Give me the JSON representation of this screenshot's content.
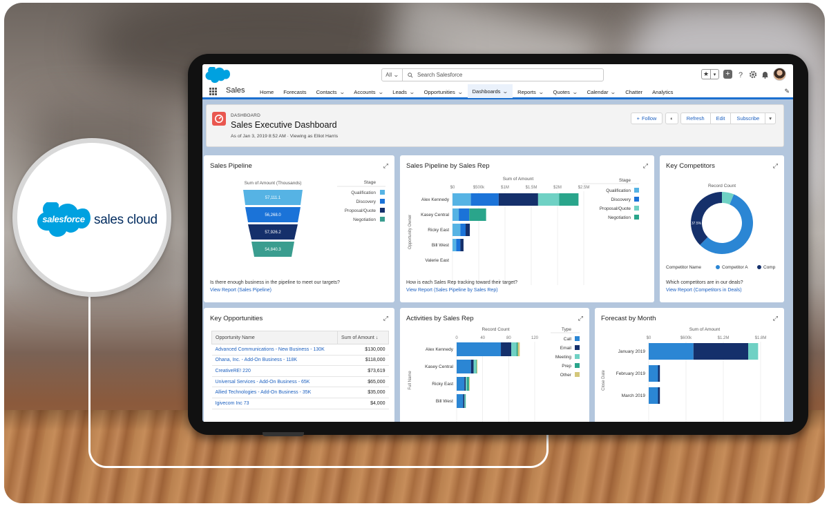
{
  "brand": {
    "logo_text": "salesforce",
    "product_text": "sales cloud"
  },
  "global_header": {
    "search_scope": "All",
    "search_placeholder": "Search Salesforce"
  },
  "nav": {
    "app_name": "Sales",
    "items": [
      {
        "label": "Home",
        "dropdown": false
      },
      {
        "label": "Forecasts",
        "dropdown": false
      },
      {
        "label": "Contacts",
        "dropdown": true
      },
      {
        "label": "Accounts",
        "dropdown": true
      },
      {
        "label": "Leads",
        "dropdown": true
      },
      {
        "label": "Opportunities",
        "dropdown": true
      },
      {
        "label": "Dashboards",
        "dropdown": true,
        "active": true
      },
      {
        "label": "Reports",
        "dropdown": true
      },
      {
        "label": "Quotes",
        "dropdown": true
      },
      {
        "label": "Calendar",
        "dropdown": true
      },
      {
        "label": "Chatter",
        "dropdown": false
      },
      {
        "label": "Analytics",
        "dropdown": false
      }
    ]
  },
  "dashboard_header": {
    "label": "DASHBOARD",
    "title": "Sales Executive Dashboard",
    "meta": "As of Jan 3, 2019 8:52 AM · Viewing as Elliot Harris",
    "follow_label": "Follow",
    "refresh_label": "Refresh",
    "edit_label": "Edit",
    "subscribe_label": "Subscribe"
  },
  "colors": {
    "qualification": "#56b3e4",
    "discovery": "#1b73d8",
    "proposal": "#15306b",
    "negotiation": "#3a9d8f",
    "call": "#2b86d4",
    "email": "#15306b",
    "meeting": "#6fd1c4",
    "prep": "#2aa58b",
    "other": "#d4c77a",
    "competitor_a": "#2b86d4",
    "competitor_b": "#15306b",
    "competitor_c": "#6fd1c4"
  },
  "cards": {
    "pipeline": {
      "title": "Sales Pipeline",
      "question": "Is there enough business in the pipeline to meet our targets?",
      "link": "View Report (Sales Pipeline)",
      "chart_data": {
        "type": "funnel",
        "axis_title": "Sum of Amount (Thousands)",
        "legend_title": "Stage",
        "stages": [
          {
            "name": "Qualification",
            "value_label": "57,111.1"
          },
          {
            "name": "Discovery",
            "value_label": "56,268.0"
          },
          {
            "name": "Proposal/Quote",
            "value_label": "57,926.2"
          },
          {
            "name": "Negotiation",
            "value_label": "54,840.3"
          }
        ]
      }
    },
    "pipeline_by_rep": {
      "title": "Sales Pipeline by Sales Rep",
      "question": "How is each Sales Rep tracking toward their target?",
      "link": "View Report (Sales Pipeline by Sales Rep)",
      "chart_data": {
        "type": "bar",
        "orientation": "horizontal",
        "stacked": true,
        "axis_title": "Sum of Amount",
        "y_axis_title": "Opportunity Owner",
        "legend_title": "Stage",
        "ticks": [
          "$0",
          "$500k",
          "$1M",
          "$1.5M",
          "$2M",
          "$2.5M"
        ],
        "xlim": [
          0,
          2500000
        ],
        "categories": [
          "Alex Kennedy",
          "Kasey Central",
          "Ricky East",
          "Bill West",
          "Valerie East"
        ],
        "series": [
          {
            "name": "Qualification",
            "values": [
              350000,
              120000,
              150000,
              70000,
              0
            ]
          },
          {
            "name": "Discovery",
            "values": [
              530000,
              200000,
              100000,
              80000,
              0
            ]
          },
          {
            "name": "Proposal/Quote",
            "values": [
              750000,
              0,
              80000,
              60000,
              0
            ]
          },
          {
            "name": "Negotiation",
            "values": [
              400000,
              0,
              0,
              0,
              0
            ]
          },
          {
            "name": "Other",
            "values": [
              370000,
              320000,
              0,
              0,
              0
            ]
          }
        ]
      }
    },
    "competitors": {
      "title": "Key Competitors",
      "question": "Which competitors are in our deals?",
      "link": "View Report (Competitors in Deals)",
      "chart_data": {
        "type": "pie",
        "donut": true,
        "axis_title": "Record Count",
        "center_label": "37.5%",
        "legend_title": "Competitor Name",
        "slices": [
          {
            "name": "Competitor A",
            "value": 56.25
          },
          {
            "name": "Comp",
            "value": 37.5
          },
          {
            "name": "",
            "value": 6.25
          }
        ]
      }
    },
    "key_opps": {
      "title": "Key Opportunities",
      "columns": [
        "Opportunity Name",
        "Sum of Amount"
      ],
      "sort_icon": "↓",
      "rows": [
        {
          "name": "Advanced Communications - New Business - 130K",
          "amount": "$130,000"
        },
        {
          "name": "Ohana, Inc. - Add-On Business - 118K",
          "amount": "$118,000"
        },
        {
          "name": "CreativeRE! 220",
          "amount": "$73,619"
        },
        {
          "name": "Universal Services - Add-On Business - 65K",
          "amount": "$65,000"
        },
        {
          "name": "Allied Technologies - Add-On Business - 35K",
          "amount": "$35,000"
        },
        {
          "name": "Igivecom Inc 73",
          "amount": "$4,000"
        }
      ]
    },
    "activities": {
      "title": "Activities by Sales Rep",
      "chart_data": {
        "type": "bar",
        "orientation": "horizontal",
        "stacked": true,
        "axis_title": "Record Count",
        "y_axis_title": "Full Name",
        "legend_title": "Type",
        "ticks": [
          "0",
          "40",
          "80",
          "120"
        ],
        "xlim": [
          0,
          120
        ],
        "categories": [
          "Alex Kennedy",
          "Kasey Central",
          "Ricky East",
          "Bill West"
        ],
        "series": [
          {
            "name": "Call",
            "values": [
              68,
              22,
              12,
              10
            ]
          },
          {
            "name": "Email",
            "values": [
              16,
              4,
              2,
              2
            ]
          },
          {
            "name": "Meeting",
            "values": [
              8,
              4,
              2,
              1
            ]
          },
          {
            "name": "Prep",
            "values": [
              2,
              1,
              3,
              1
            ]
          },
          {
            "name": "Other",
            "values": [
              3,
              1,
              1,
              0
            ]
          }
        ]
      }
    },
    "forecast": {
      "title": "Forecast by Month",
      "chart_data": {
        "type": "bar",
        "orientation": "horizontal",
        "stacked": true,
        "axis_title": "Sum of Amount",
        "y_axis_title": "Close Date",
        "ticks": [
          "$0",
          "$600k",
          "$1.2M",
          "$1.8M"
        ],
        "xlim": [
          0,
          1800000
        ],
        "categories": [
          "January 2019",
          "February 2019",
          "March 2019"
        ],
        "series": [
          {
            "name": "Call",
            "values": [
              720000,
              150000,
              150000
            ]
          },
          {
            "name": "Email",
            "values": [
              880000,
              30000,
              30000
            ]
          },
          {
            "name": "Meeting",
            "values": [
              160000,
              0,
              0
            ]
          }
        ]
      }
    }
  }
}
